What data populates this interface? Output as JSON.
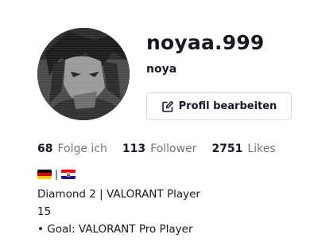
{
  "profile": {
    "username": "noyaa.999",
    "nickname": "noya",
    "avatar_icon": "profile-photo",
    "edit_button": {
      "label": "Profil bearbeiten",
      "icon": "edit-icon"
    }
  },
  "stats": [
    {
      "value": "68",
      "label": "Folge ich"
    },
    {
      "value": "113",
      "label": "Follower"
    },
    {
      "value": "2751",
      "label": "Likes"
    }
  ],
  "bio": {
    "flags": [
      "germany-flag",
      "croatia-flag"
    ],
    "separator": "|",
    "lines": [
      "Diamond 2 | VALORANT Player",
      "15",
      "• Goal: VALORANT Pro Player"
    ]
  },
  "colors": {
    "text_primary": "#161823",
    "text_secondary": "#73757c",
    "border": "#dcdcde",
    "background": "#ffffff"
  }
}
